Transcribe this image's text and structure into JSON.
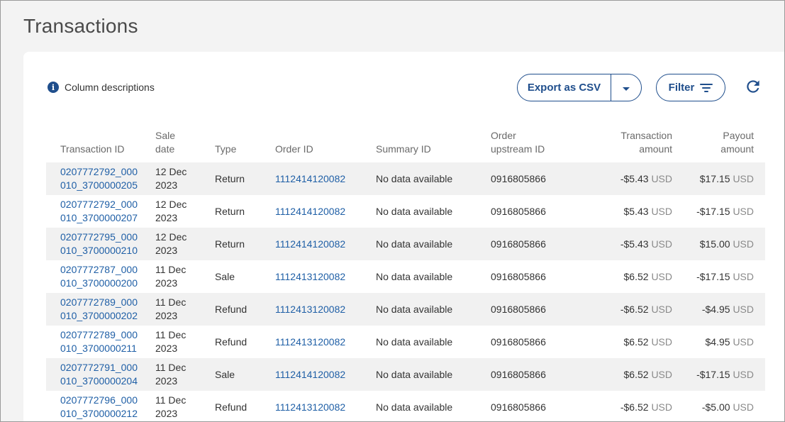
{
  "page": {
    "title": "Transactions"
  },
  "toolbar": {
    "column_descriptions": "Column descriptions",
    "export_label": "Export as CSV",
    "filter_label": "Filter"
  },
  "colors": {
    "accent": "#1f4e8c",
    "link": "#1f5fa6",
    "stripe": "#f1f1f1"
  },
  "icons": [
    "info-icon",
    "chevron-down-icon",
    "filter-icon",
    "refresh-icon"
  ],
  "table": {
    "headers": {
      "transaction_id": "Transaction ID",
      "sale_date": "Sale date",
      "type": "Type",
      "order_id": "Order ID",
      "summary_id": "Summary ID",
      "order_upstream_id": "Order upstream ID",
      "transaction_amount": "Transaction amount",
      "payout_amount": "Payout amount"
    },
    "rows": [
      {
        "txn1": "0207772792_000",
        "txn2": "010_3700000205",
        "date1": "12 Dec",
        "date2": "2023",
        "type": "Return",
        "order": "1112414120082",
        "summary": "No data available",
        "upstream": "0916805866",
        "amt": "-$5.43",
        "amt_cur": "USD",
        "pay": "$17.15",
        "pay_cur": "USD"
      },
      {
        "txn1": "0207772792_000",
        "txn2": "010_3700000207",
        "date1": "12 Dec",
        "date2": "2023",
        "type": "Return",
        "order": "1112414120082",
        "summary": "No data available",
        "upstream": "0916805866",
        "amt": "$5.43",
        "amt_cur": "USD",
        "pay": "-$17.15",
        "pay_cur": "USD"
      },
      {
        "txn1": "0207772795_000",
        "txn2": "010_3700000210",
        "date1": "12 Dec",
        "date2": "2023",
        "type": "Return",
        "order": "1112414120082",
        "summary": "No data available",
        "upstream": "0916805866",
        "amt": "-$5.43",
        "amt_cur": "USD",
        "pay": "$15.00",
        "pay_cur": "USD"
      },
      {
        "txn1": "0207772787_000",
        "txn2": "010_3700000200",
        "date1": "11 Dec",
        "date2": "2023",
        "type": "Sale",
        "order": "1112413120082",
        "summary": "No data available",
        "upstream": "0916805866",
        "amt": "$6.52",
        "amt_cur": "USD",
        "pay": "-$17.15",
        "pay_cur": "USD"
      },
      {
        "txn1": "0207772789_000",
        "txn2": "010_3700000202",
        "date1": "11 Dec",
        "date2": "2023",
        "type": "Refund",
        "order": "1112413120082",
        "summary": "No data available",
        "upstream": "0916805866",
        "amt": "-$6.52",
        "amt_cur": "USD",
        "pay": "-$4.95",
        "pay_cur": "USD"
      },
      {
        "txn1": "0207772789_000",
        "txn2": "010_3700000211",
        "date1": "11 Dec",
        "date2": "2023",
        "type": "Refund",
        "order": "1112413120082",
        "summary": "No data available",
        "upstream": "0916805866",
        "amt": "$6.52",
        "amt_cur": "USD",
        "pay": "$4.95",
        "pay_cur": "USD"
      },
      {
        "txn1": "0207772791_000",
        "txn2": "010_3700000204",
        "date1": "11 Dec",
        "date2": "2023",
        "type": "Sale",
        "order": "1112414120082",
        "summary": "No data available",
        "upstream": "0916805866",
        "amt": "$6.52",
        "amt_cur": "USD",
        "pay": "-$17.15",
        "pay_cur": "USD"
      },
      {
        "txn1": "0207772796_000",
        "txn2": "010_3700000212",
        "date1": "11 Dec",
        "date2": "2023",
        "type": "Refund",
        "order": "1112413120082",
        "summary": "No data available",
        "upstream": "0916805866",
        "amt": "-$6.52",
        "amt_cur": "USD",
        "pay": "-$5.00",
        "pay_cur": "USD"
      }
    ]
  }
}
